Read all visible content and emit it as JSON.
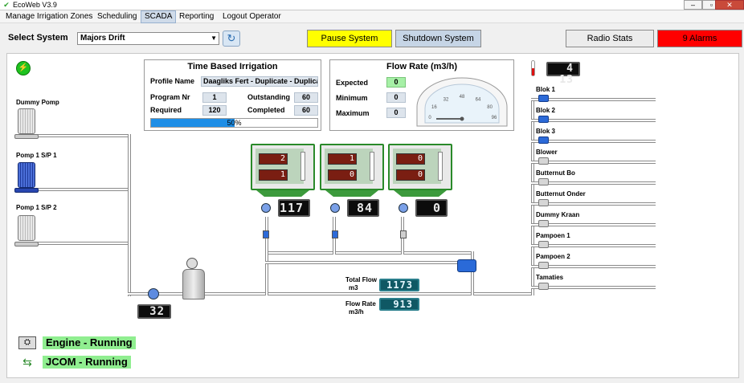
{
  "window": {
    "title": "EcoWeb V3.9"
  },
  "menu": {
    "items": [
      "Manage Irrigation Zones",
      "Scheduling",
      "SCADA",
      "Reporting",
      "Logout Operator"
    ],
    "active": "SCADA"
  },
  "toolbar": {
    "select_label": "Select System",
    "system_value": "Majors Drift",
    "pause_label": "Pause System",
    "shutdown_label": "Shutdown System",
    "radio_label": "Radio Stats",
    "alarms_label": "9 Alarms"
  },
  "colors": {
    "pause": "#ffff00",
    "alarms": "#ff0000",
    "running": "#90ee90",
    "tank_border": "#2a8a2a"
  },
  "tbi": {
    "title": "Time Based Irrigation",
    "profile_label": "Profile Name",
    "profile_value": "Daagliks Fert - Duplicate - Duplicat",
    "program_label": "Program Nr",
    "program_value": "1",
    "required_label": "Required",
    "required_value": "120",
    "outstanding_label": "Outstanding",
    "outstanding_value": "60",
    "completed_label": "Completed",
    "completed_value": "60",
    "progress_text": "50%",
    "progress_fraction": 0.5
  },
  "flow": {
    "title": "Flow Rate (m3/h)",
    "expected_label": "Expected",
    "expected_value": "0",
    "minimum_label": "Minimum",
    "minimum_value": "0",
    "maximum_label": "Maximum",
    "maximum_value": "0",
    "gauge_ticks": [
      "0",
      "16",
      "32",
      "48",
      "64",
      "80",
      "96"
    ],
    "gauge_value": 0
  },
  "temperature": {
    "value": "4 13"
  },
  "pumps": [
    {
      "label": "Dummy Pomp",
      "state": "off"
    },
    {
      "label": "Pomp 1 S/P 1",
      "state": "on"
    },
    {
      "label": "Pomp 1 S/P 2",
      "state": "off"
    }
  ],
  "tanks": [
    {
      "top": "2",
      "bottom": "1",
      "display": "117"
    },
    {
      "top": "1",
      "bottom": "0",
      "display": "84"
    },
    {
      "top": "0",
      "bottom": "0",
      "display": "0"
    }
  ],
  "pressure_display": "32",
  "total_flow": {
    "label": "Total Flow",
    "unit": "m3",
    "value": "1173"
  },
  "flow_rate": {
    "label": "Flow Rate",
    "unit": "m3/h",
    "value": "913"
  },
  "outlets": [
    "Blok 1",
    "Blok 2",
    "Blok 3",
    "Blower",
    "Butternut Bo",
    "Butternut Onder",
    "Dummy Kraan",
    "Pampoen 1",
    "Pampoen 2",
    "Tamaties"
  ],
  "status": {
    "engine": "Engine - Running",
    "jcom": "JCOM - Running"
  }
}
